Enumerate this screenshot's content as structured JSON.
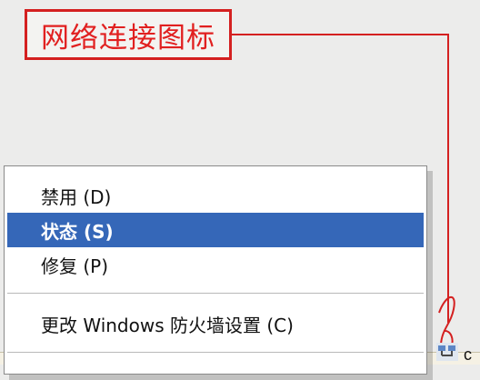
{
  "annotation": {
    "label": "网络连接图标",
    "color": "#d42020"
  },
  "context_menu": {
    "items": [
      {
        "label": "禁用 (D)"
      },
      {
        "label": "状态 (S)",
        "selected": true
      },
      {
        "label": "修复 (P)"
      },
      {
        "label": "更改 Windows 防火墙设置 (C)"
      }
    ],
    "selected_color": "#3567b8"
  },
  "taskbar": {
    "tray": {
      "network_icon": "network-connection-icon",
      "partial_text": "c"
    }
  }
}
